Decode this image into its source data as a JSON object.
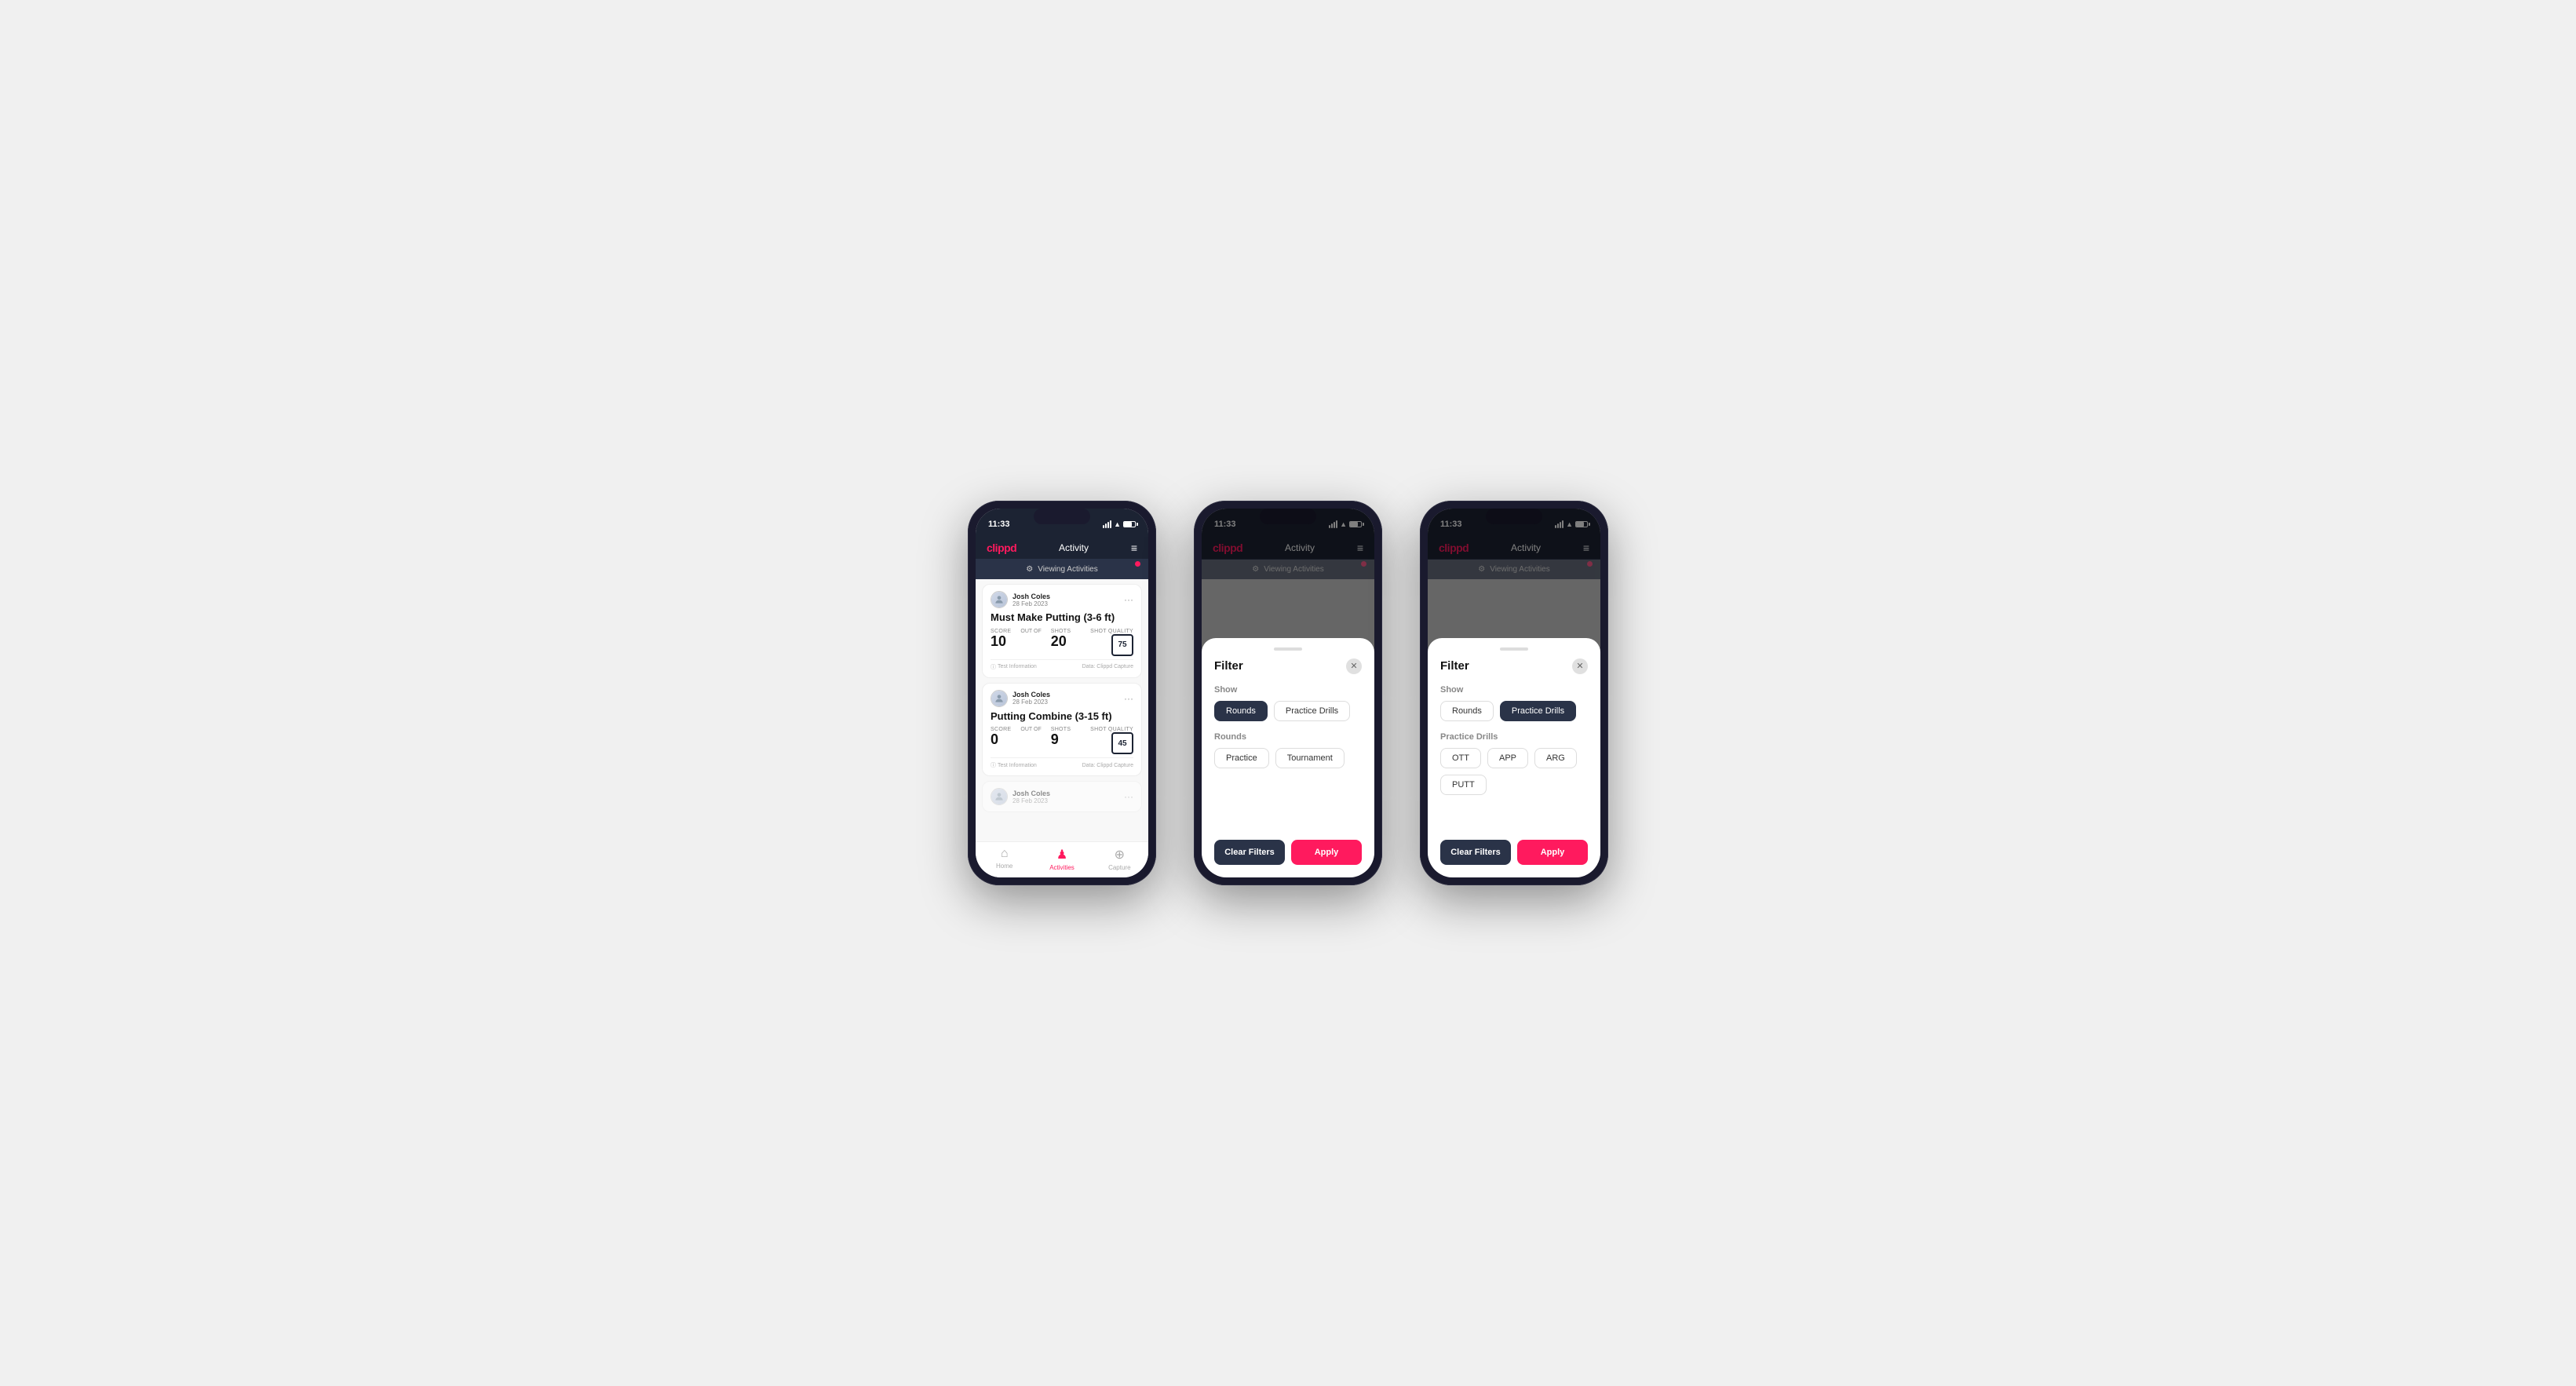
{
  "app": {
    "logo": "clippd",
    "nav_title": "Activity",
    "menu_icon": "≡"
  },
  "status_bar": {
    "time": "11:33"
  },
  "viewing_bar": {
    "text": "Viewing Activities"
  },
  "phone1": {
    "cards": [
      {
        "user_name": "Josh Coles",
        "user_date": "28 Feb 2023",
        "activity_title": "Must Make Putting (3-6 ft)",
        "score_label": "Score",
        "score_value": "10",
        "outof": "OUT OF",
        "shots_label": "Shots",
        "shots_value": "20",
        "shot_quality_label": "Shot Quality",
        "shot_quality_value": "75",
        "test_info": "Test Information",
        "data_source": "Data: Clippd Capture"
      },
      {
        "user_name": "Josh Coles",
        "user_date": "28 Feb 2023",
        "activity_title": "Putting Combine (3-15 ft)",
        "score_label": "Score",
        "score_value": "0",
        "outof": "OUT OF",
        "shots_label": "Shots",
        "shots_value": "9",
        "shot_quality_label": "Shot Quality",
        "shot_quality_value": "45",
        "test_info": "Test Information",
        "data_source": "Data: Clippd Capture"
      }
    ],
    "bottom_nav": [
      {
        "icon": "⌂",
        "label": "Home",
        "active": false
      },
      {
        "icon": "♙",
        "label": "Activities",
        "active": true
      },
      {
        "icon": "⊕",
        "label": "Capture",
        "active": false
      }
    ]
  },
  "phone2": {
    "filter": {
      "title": "Filter",
      "show_label": "Show",
      "show_buttons": [
        {
          "label": "Rounds",
          "active": true
        },
        {
          "label": "Practice Drills",
          "active": false
        }
      ],
      "rounds_label": "Rounds",
      "round_buttons": [
        {
          "label": "Practice",
          "active": false
        },
        {
          "label": "Tournament",
          "active": false
        }
      ],
      "clear_label": "Clear Filters",
      "apply_label": "Apply"
    }
  },
  "phone3": {
    "filter": {
      "title": "Filter",
      "show_label": "Show",
      "show_buttons": [
        {
          "label": "Rounds",
          "active": false
        },
        {
          "label": "Practice Drills",
          "active": true
        }
      ],
      "drills_label": "Practice Drills",
      "drill_buttons": [
        {
          "label": "OTT",
          "active": false
        },
        {
          "label": "APP",
          "active": false
        },
        {
          "label": "ARG",
          "active": false
        },
        {
          "label": "PUTT",
          "active": false
        }
      ],
      "clear_label": "Clear Filters",
      "apply_label": "Apply"
    }
  }
}
